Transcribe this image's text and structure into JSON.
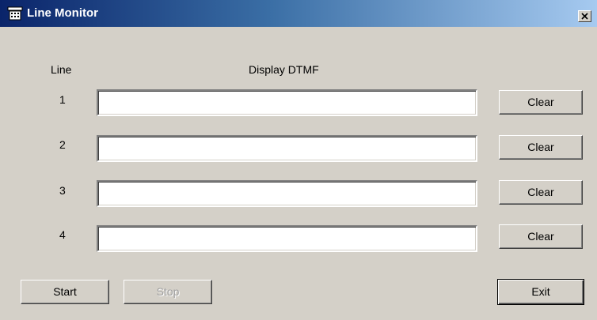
{
  "window": {
    "title": "Line Monitor"
  },
  "headers": {
    "line": "Line",
    "display": "Display DTMF"
  },
  "lines": [
    {
      "number": "1",
      "value": "",
      "clear_label": "Clear"
    },
    {
      "number": "2",
      "value": "",
      "clear_label": "Clear"
    },
    {
      "number": "3",
      "value": "",
      "clear_label": "Clear"
    },
    {
      "number": "4",
      "value": "",
      "clear_label": "Clear"
    }
  ],
  "buttons": {
    "start": "Start",
    "stop": "Stop",
    "exit": "Exit"
  },
  "icons": {
    "title": "telephone-icon",
    "close": "close-icon"
  },
  "colors": {
    "titlebar_start": "#0a246a",
    "titlebar_end": "#a6caf0",
    "window_bg": "#d4d0c8"
  }
}
